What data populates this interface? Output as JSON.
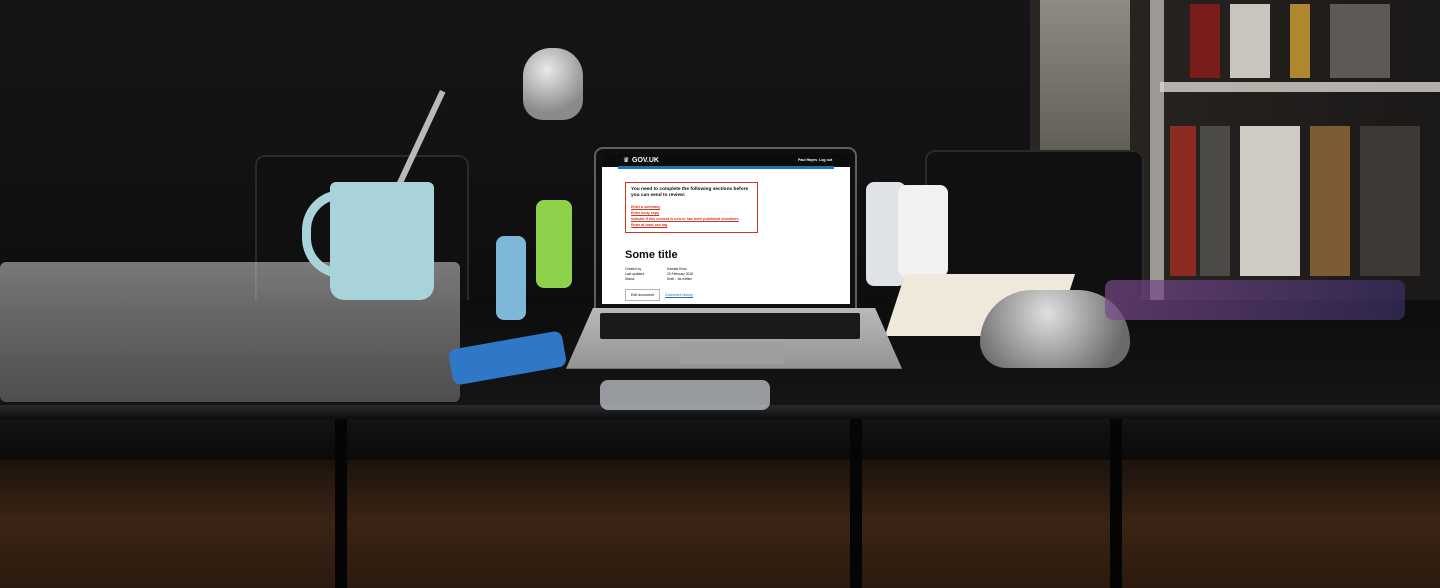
{
  "header": {
    "logo": "GOV.UK",
    "crown_icon": "crown-icon",
    "user_name": "Paul Hayes",
    "logout": "Log out",
    "accent_color": "#1d70b8"
  },
  "error_summary": {
    "title": "You need to complete the following sections before you can send to review:",
    "border_color": "#d4351c",
    "links": [
      "Enter a summary",
      "Enter body copy",
      "Indicate if this content is new or has been published elsewhere",
      "Enter at least one tag"
    ]
  },
  "document": {
    "title": "Some title",
    "meta": [
      {
        "label": "Created by",
        "value": "Kamala Khan"
      },
      {
        "label": "Last updated",
        "value": "20 February 2018"
      },
      {
        "label": "Status",
        "value": "Draft - 1st edition"
      }
    ],
    "edit_button": "Edit document",
    "history_link": "Document history"
  }
}
